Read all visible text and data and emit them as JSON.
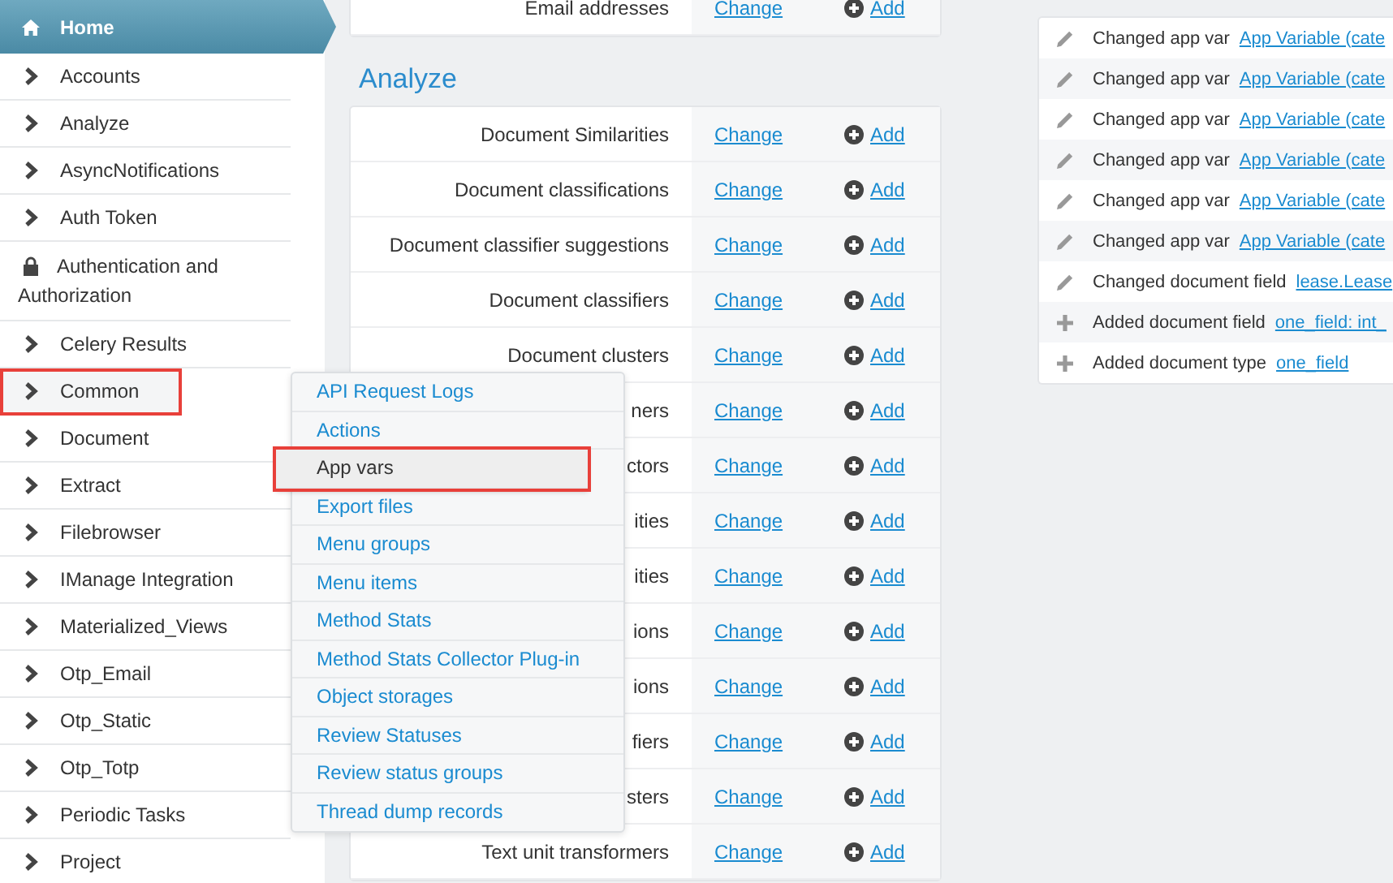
{
  "sidebar": {
    "items": [
      {
        "label": "Home",
        "kind": "home",
        "selected": true
      },
      {
        "label": "Accounts",
        "kind": "chevron",
        "selected": false
      },
      {
        "label": "Analyze",
        "kind": "chevron",
        "selected": false
      },
      {
        "label": "AsyncNotifications",
        "kind": "chevron",
        "selected": false
      },
      {
        "label": "Auth Token",
        "kind": "chevron",
        "selected": false
      },
      {
        "label": "Authentication and Authorization",
        "kind": "lock",
        "selected": false
      },
      {
        "label": "Celery Results",
        "kind": "chevron",
        "selected": false
      },
      {
        "label": "Common",
        "kind": "chevron",
        "selected": true
      },
      {
        "label": "Document",
        "kind": "chevron",
        "selected": false
      },
      {
        "label": "Extract",
        "kind": "chevron",
        "selected": false
      },
      {
        "label": "Filebrowser",
        "kind": "chevron",
        "selected": false
      },
      {
        "label": "IManage Integration",
        "kind": "chevron",
        "selected": false
      },
      {
        "label": "Materialized_Views",
        "kind": "chevron",
        "selected": false
      },
      {
        "label": "Otp_Email",
        "kind": "chevron",
        "selected": false
      },
      {
        "label": "Otp_Static",
        "kind": "chevron",
        "selected": false
      },
      {
        "label": "Otp_Totp",
        "kind": "chevron",
        "selected": false
      },
      {
        "label": "Periodic Tasks",
        "kind": "chevron",
        "selected": false
      },
      {
        "label": "Project",
        "kind": "chevron",
        "selected": false
      }
    ]
  },
  "dropdown_menu": {
    "items": [
      {
        "label": "API Request Logs",
        "selected": false
      },
      {
        "label": "Actions",
        "selected": false
      },
      {
        "label": "App vars",
        "selected": true
      },
      {
        "label": "Export files",
        "selected": false
      },
      {
        "label": "Menu groups",
        "selected": false
      },
      {
        "label": "Menu items",
        "selected": false
      },
      {
        "label": "Method Stats",
        "selected": false
      },
      {
        "label": "Method Stats Collector Plug-in",
        "selected": false
      },
      {
        "label": "Object storages",
        "selected": false
      },
      {
        "label": "Review Statuses",
        "selected": false
      },
      {
        "label": "Review status groups",
        "selected": false
      },
      {
        "label": "Thread dump records",
        "selected": false
      }
    ]
  },
  "top_table": {
    "rows": [
      {
        "label": "Email addresses",
        "change": "Change",
        "add": "Add"
      }
    ]
  },
  "analyze": {
    "title": "Analyze",
    "rows": [
      {
        "label": "Document Similarities",
        "change": "Change",
        "add": "Add"
      },
      {
        "label": "Document classifications",
        "change": "Change",
        "add": "Add"
      },
      {
        "label": "Document classifier suggestions",
        "change": "Change",
        "add": "Add"
      },
      {
        "label": "Document classifiers",
        "change": "Change",
        "add": "Add"
      },
      {
        "label": "Document clusters",
        "change": "Change",
        "add": "Add"
      },
      {
        "label": "ners",
        "change": "Change",
        "add": "Add"
      },
      {
        "label": "ctors",
        "change": "Change",
        "add": "Add"
      },
      {
        "label": "ities",
        "change": "Change",
        "add": "Add"
      },
      {
        "label": "ities",
        "change": "Change",
        "add": "Add"
      },
      {
        "label": "ions",
        "change": "Change",
        "add": "Add"
      },
      {
        "label": "ions",
        "change": "Change",
        "add": "Add"
      },
      {
        "label": "fiers",
        "change": "Change",
        "add": "Add"
      },
      {
        "label": "sters",
        "change": "Change",
        "add": "Add"
      },
      {
        "label": "Text unit transformers",
        "change": "Change",
        "add": "Add"
      }
    ]
  },
  "recent_actions": {
    "items": [
      {
        "kind": "changed",
        "text": "Changed app var",
        "link": "App Variable (cate"
      },
      {
        "kind": "changed",
        "text": "Changed app var",
        "link": "App Variable (cate"
      },
      {
        "kind": "changed",
        "text": "Changed app var",
        "link": "App Variable (cate"
      },
      {
        "kind": "changed",
        "text": "Changed app var",
        "link": "App Variable (cate"
      },
      {
        "kind": "changed",
        "text": "Changed app var",
        "link": "App Variable (cate"
      },
      {
        "kind": "changed",
        "text": "Changed app var",
        "link": "App Variable (cate"
      },
      {
        "kind": "changed",
        "text": "Changed document field",
        "link": "lease.Lease"
      },
      {
        "kind": "added",
        "text": "Added document field",
        "link": "one_field: int_"
      },
      {
        "kind": "added",
        "text": "Added document type",
        "link": "one_field"
      }
    ]
  }
}
